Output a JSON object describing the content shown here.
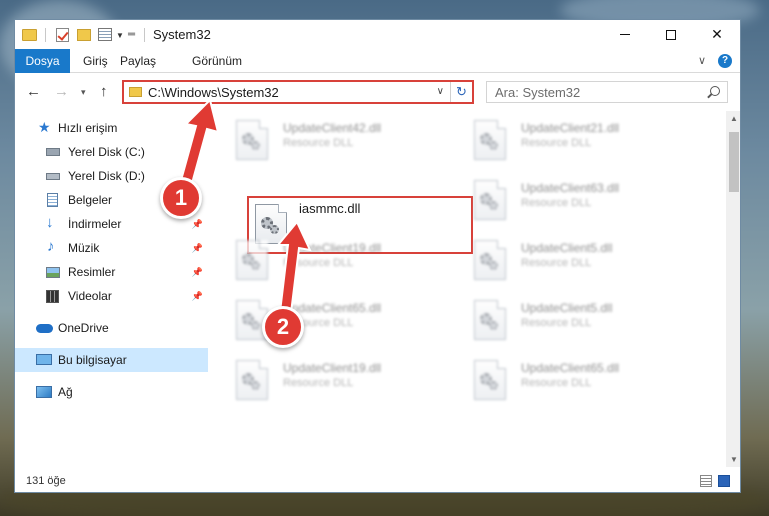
{
  "window": {
    "title": "System32",
    "controls": {
      "minimize": "—",
      "maximize": "☐",
      "close": "✕"
    }
  },
  "ribbon": {
    "tabs": [
      {
        "label": "Dosya",
        "active": true
      },
      {
        "label": "Giriş"
      },
      {
        "label": "Paylaş"
      },
      {
        "label": "Görünüm"
      }
    ],
    "help": "?"
  },
  "navigation": {
    "address": "C:\\Windows\\System32",
    "search_placeholder": "Ara: System32"
  },
  "sidebar": {
    "items": [
      {
        "label": "Hızlı erişim",
        "icon": "star-icon"
      },
      {
        "label": "Yerel Disk (C:)",
        "icon": "drive-icon",
        "pinned": true
      },
      {
        "label": "Yerel Disk (D:)",
        "icon": "drive-icon",
        "pinned": true
      },
      {
        "label": "Belgeler",
        "icon": "documents-icon",
        "pinned": true
      },
      {
        "label": "İndirmeler",
        "icon": "downloads-icon",
        "pinned": true
      },
      {
        "label": "Müzik",
        "icon": "music-icon",
        "pinned": true
      },
      {
        "label": "Resimler",
        "icon": "pictures-icon",
        "pinned": true
      },
      {
        "label": "Videolar",
        "icon": "videos-icon",
        "pinned": true
      },
      {
        "label": "OneDrive",
        "icon": "cloud-icon"
      },
      {
        "label": "Bu bilgisayar",
        "icon": "computer-icon",
        "selected": true
      },
      {
        "label": "Ağ",
        "icon": "network-icon"
      }
    ]
  },
  "files": {
    "focused": {
      "name": "iasmmc.dll"
    },
    "blurred": [
      {
        "name": "UpdateClient42.dll",
        "type": "Resource DLL"
      },
      {
        "name": "UpdateClient21.dll",
        "type": "Resource DLL"
      },
      {
        "name": "UpdateClient63.dll",
        "type": "Resource DLL"
      },
      {
        "name": "UpdateClient19.dll",
        "type": "Resource DLL"
      },
      {
        "name": "UpdateClient5.dll",
        "type": "Resource DLL"
      },
      {
        "name": "UpdateClient65.dll",
        "type": "Resource DLL"
      },
      {
        "name": "UpdateClient5.dll",
        "type": "Resource DLL"
      },
      {
        "name": "UpdateClient19.dll",
        "type": "Resource DLL"
      },
      {
        "name": "UpdateClient65.dll",
        "type": "Resource DLL"
      }
    ]
  },
  "status": {
    "count": "131 öğe"
  },
  "annotations": {
    "step1": "1",
    "step2": "2",
    "color": "#e03a33"
  }
}
